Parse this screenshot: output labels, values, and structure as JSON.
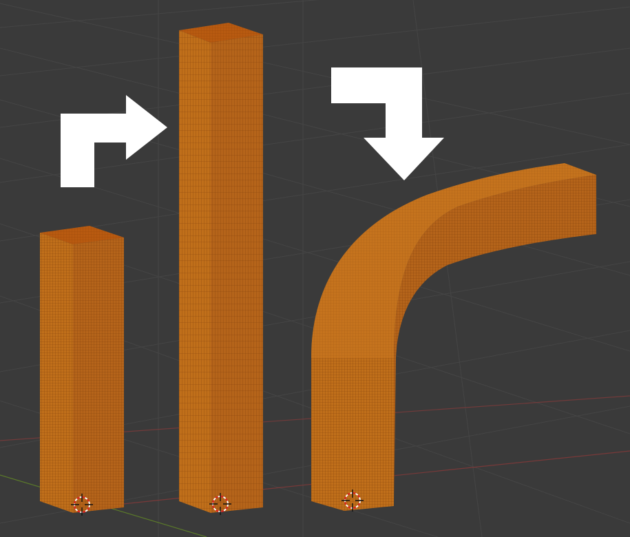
{
  "scene": {
    "colors": {
      "background": "#3a3a3a",
      "grid_line": "#454545",
      "axis_x": "#8a3a3a",
      "axis_y": "#5b7a2a",
      "mesh_front": "#c06f1a",
      "mesh_side": "#b5641a",
      "mesh_top": "#b85a10",
      "wire": "#7a3a0a",
      "arrow_fill": "#ffffff",
      "cursor_red": "#e02020",
      "cursor_white": "#ffffff"
    },
    "objects": [
      {
        "name": "short-bar",
        "kind": "straight-mesh"
      },
      {
        "name": "tall-bar",
        "kind": "stretched-mesh"
      },
      {
        "name": "bent-bar",
        "kind": "curved-mesh"
      }
    ],
    "arrows": [
      {
        "name": "right-turn-arrow",
        "icon": "turn-right-arrow-icon"
      },
      {
        "name": "down-turn-arrow",
        "icon": "turn-down-arrow-icon"
      }
    ],
    "cursor_icon": "3d-cursor-icon"
  }
}
